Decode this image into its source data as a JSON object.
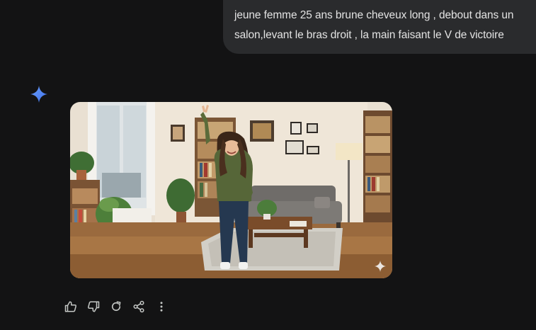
{
  "conversation": {
    "user_prompt": "jeune femme 25 ans brune cheveux long , debout dans un salon,levant le bras droit , la main faisant le V de victoire"
  },
  "response": {
    "spark_icon": "gemini-sparkle-icon",
    "image_watermark_icon": "sparkle-icon"
  },
  "actions": {
    "items": [
      {
        "icon": "thumb-up-icon"
      },
      {
        "icon": "thumb-down-icon"
      },
      {
        "icon": "regenerate-icon"
      },
      {
        "icon": "share-icon"
      },
      {
        "icon": "more-vert-icon"
      }
    ]
  },
  "colors": {
    "background": "#131314",
    "bubble": "#2a2b2d",
    "text": "#e3e3e3",
    "icon": "#c4c7c5",
    "spark_blue": "#4e84f5"
  }
}
